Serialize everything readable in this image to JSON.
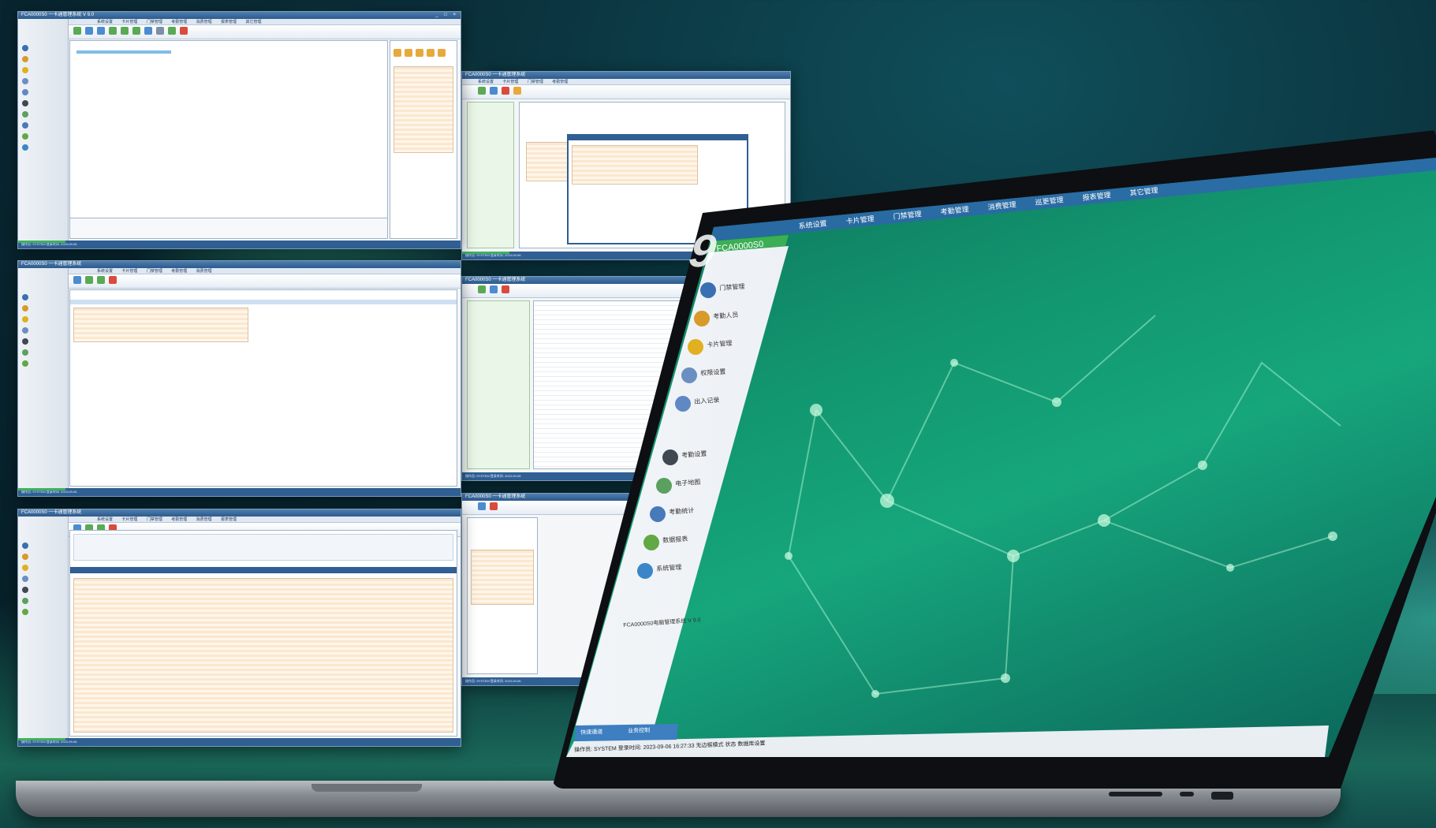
{
  "foreground_app": {
    "brand": "FCA0000S0",
    "version_mark": "9",
    "menu": [
      "系统设置",
      "卡片管理",
      "门禁管理",
      "考勤管理",
      "消费管理",
      "巡更管理",
      "报表管理",
      "其它管理"
    ],
    "sidebar_items": [
      {
        "label": "门禁管理",
        "icon": "door-icon",
        "color": "#3a6fb3"
      },
      {
        "label": "考勤人员",
        "icon": "people-icon",
        "color": "#d89a28"
      },
      {
        "label": "卡片管理",
        "icon": "card-icon",
        "color": "#e0b020"
      },
      {
        "label": "权限设置",
        "icon": "key-icon",
        "color": "#6b8fc2"
      },
      {
        "label": "出入记录",
        "icon": "record-icon",
        "color": "#5f88c5"
      },
      {
        "label": "考勤设置",
        "icon": "camera-icon",
        "color": "#404952"
      },
      {
        "label": "电子地图",
        "icon": "map-icon",
        "color": "#5ba05f"
      },
      {
        "label": "考勤统计",
        "icon": "chart-icon",
        "color": "#4879b9"
      },
      {
        "label": "数据报表",
        "icon": "report-icon",
        "color": "#62a845"
      },
      {
        "label": "系统管理",
        "icon": "gear-icon",
        "color": "#3a86c8"
      }
    ],
    "footer_link": "FCA0000S0电脑管理系统 V 9.0",
    "tabs": [
      "快速通道",
      "业务控制"
    ],
    "status_bar": "操作员: SYSTEM   登录时间: 2023-09-06 16:27:33   无边框模式   状态   数据库设置"
  },
  "windows": {
    "w1_title": "FCA0000S0 一卡通管理系统 V 9.0",
    "w2_title": "FCA0000S0 一卡通管理系统",
    "w3_title": "FCA0000S0 一卡通管理系统",
    "w4_title": "FCA0000S0 一卡通管理系统",
    "w5_title": "FCA0000S0 一卡通管理系统",
    "w6_title": "FCA0000S0 一卡通管理系统",
    "menu": [
      "系统设置",
      "卡片管理",
      "门禁管理",
      "考勤管理",
      "消费管理",
      "报表管理",
      "其它管理"
    ],
    "status": "操作员: SYSTEM  登录时间: 2023-09-06"
  },
  "colors": {
    "accent_blue": "#2f5f93",
    "accent_green": "#3db35a",
    "screen_green": "#12966f"
  }
}
